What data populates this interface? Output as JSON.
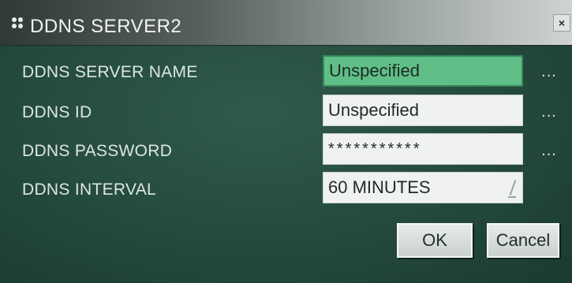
{
  "window": {
    "title": "DDNS SERVER2",
    "close_label": "×"
  },
  "fields": [
    {
      "label": "DDNS SERVER NAME",
      "value": "Unspecified",
      "more": "..."
    },
    {
      "label": "DDNS ID",
      "value": "Unspecified",
      "more": "..."
    },
    {
      "label": "DDNS PASSWORD",
      "value": "***********",
      "more": "..."
    },
    {
      "label": "DDNS INTERVAL",
      "value": "60 MINUTES"
    }
  ],
  "buttons": {
    "ok": "OK",
    "cancel": "Cancel"
  },
  "colors": {
    "panel": "#244a3c",
    "active_field": "#5fbf87"
  },
  "icons": {
    "title": "app-grid-icon",
    "close": "close-icon",
    "interval": "spinner-icon"
  }
}
